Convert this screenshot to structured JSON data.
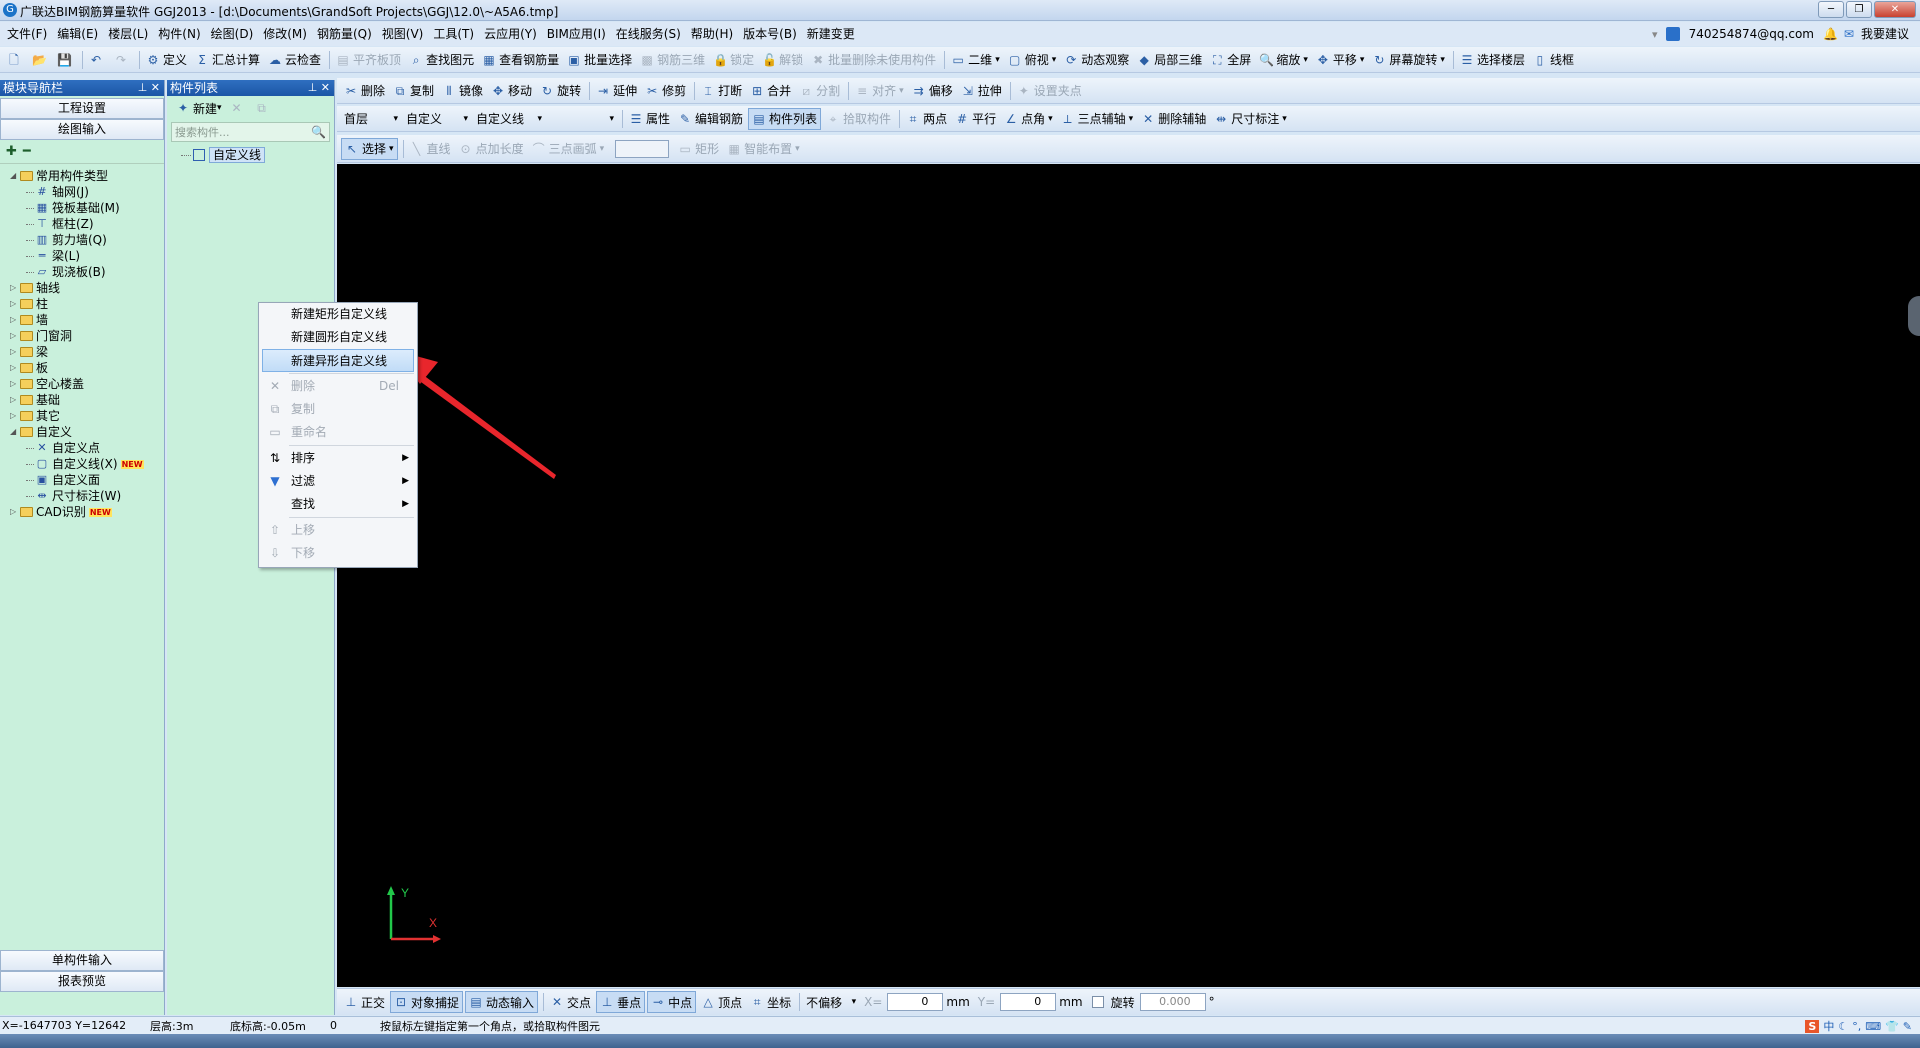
{
  "window": {
    "title": "广联达BIM钢筋算量软件 GGJ2013 - [d:\\Documents\\GrandSoft Projects\\GGJ\\12.0\\~A5A6.tmp]",
    "account": "740254874@qq.com",
    "help_label": "我要建议"
  },
  "menu": [
    "文件(F)",
    "编辑(E)",
    "楼层(L)",
    "构件(N)",
    "绘图(D)",
    "修改(M)",
    "钢筋量(Q)",
    "视图(V)",
    "工具(T)",
    "云应用(Y)",
    "BIM应用(I)",
    "在线服务(S)",
    "帮助(H)",
    "版本号(B)",
    "新建变更"
  ],
  "toolbar1": [
    "定义",
    "汇总计算",
    "云检查",
    "平齐板顶",
    "查找图元",
    "查看钢筋量",
    "批量选择",
    "钢筋三维",
    "锁定",
    "解锁",
    "批量删除未使用构件",
    "二维",
    "俯视",
    "动态观察",
    "局部三维",
    "全屏",
    "缩放",
    "平移",
    "屏幕旋转",
    "选择楼层",
    "线框"
  ],
  "toolbar2": [
    "删除",
    "复制",
    "镜像",
    "移动",
    "旋转",
    "延伸",
    "修剪",
    "打断",
    "合并",
    "分割",
    "对齐",
    "偏移",
    "拉伸",
    "设置夹点"
  ],
  "toolbar3": {
    "floor": "首层",
    "category": "自定义",
    "component": "自定义线",
    "items": [
      "属性",
      "编辑钢筋",
      "构件列表",
      "拾取构件",
      "两点",
      "平行",
      "点角",
      "三点辅轴",
      "删除辅轴",
      "尺寸标注"
    ]
  },
  "toolbar4": [
    "选择",
    "直线",
    "点加长度",
    "三点画弧",
    "矩形",
    "智能布置"
  ],
  "nav_panel": {
    "title": "模块导航栏",
    "project_settings": "工程设置",
    "drawing_input": "绘图输入",
    "single_input": "单构件输入",
    "report_preview": "报表预览",
    "tree": [
      {
        "label": "常用构件类型",
        "level": 0,
        "type": "folder-open"
      },
      {
        "label": "轴网(J)",
        "level": 1,
        "type": "grid-icon"
      },
      {
        "label": "筏板基础(M)",
        "level": 1,
        "type": "raft-icon"
      },
      {
        "label": "框柱(Z)",
        "level": 1,
        "type": "column-icon"
      },
      {
        "label": "剪力墙(Q)",
        "level": 1,
        "type": "wall-icon"
      },
      {
        "label": "梁(L)",
        "level": 1,
        "type": "beam-icon"
      },
      {
        "label": "现浇板(B)",
        "level": 1,
        "type": "slab-icon"
      },
      {
        "label": "轴线",
        "level": 0,
        "type": "folder"
      },
      {
        "label": "柱",
        "level": 0,
        "type": "folder"
      },
      {
        "label": "墙",
        "level": 0,
        "type": "folder"
      },
      {
        "label": "门窗洞",
        "level": 0,
        "type": "folder"
      },
      {
        "label": "梁",
        "level": 0,
        "type": "folder"
      },
      {
        "label": "板",
        "level": 0,
        "type": "folder"
      },
      {
        "label": "空心楼盖",
        "level": 0,
        "type": "folder"
      },
      {
        "label": "基础",
        "level": 0,
        "type": "folder"
      },
      {
        "label": "其它",
        "level": 0,
        "type": "folder"
      },
      {
        "label": "自定义",
        "level": 0,
        "type": "folder-open"
      },
      {
        "label": "自定义点",
        "level": 1,
        "type": "point-icon"
      },
      {
        "label": "自定义线(X)",
        "level": 1,
        "type": "line-icon",
        "badge": "NEW"
      },
      {
        "label": "自定义面",
        "level": 1,
        "type": "face-icon"
      },
      {
        "label": "尺寸标注(W)",
        "level": 1,
        "type": "dim-icon"
      },
      {
        "label": "CAD识别",
        "level": 0,
        "type": "folder",
        "badge": "NEW"
      }
    ]
  },
  "component_list": {
    "title": "构件列表",
    "new_label": "新建",
    "search_placeholder": "搜索构件...",
    "items": [
      "自定义线"
    ]
  },
  "context_menu": [
    {
      "label": "新建矩形自定义线",
      "enabled": true
    },
    {
      "label": "新建圆形自定义线",
      "enabled": true
    },
    {
      "label": "新建异形自定义线",
      "enabled": true,
      "highlighted": true
    },
    {
      "label": "删除",
      "enabled": false,
      "shortcut": "Del"
    },
    {
      "label": "复制",
      "enabled": false
    },
    {
      "label": "重命名",
      "enabled": false
    },
    {
      "label": "排序",
      "enabled": true,
      "submenu": true
    },
    {
      "label": "过滤",
      "enabled": true,
      "submenu": true
    },
    {
      "label": "查找",
      "enabled": true,
      "submenu": true
    },
    {
      "label": "上移",
      "enabled": false
    },
    {
      "label": "下移",
      "enabled": false
    }
  ],
  "snap_bar": {
    "items": [
      "正交",
      "对象捕捉",
      "动态输入",
      "交点",
      "垂点",
      "中点",
      "顶点",
      "坐标"
    ],
    "offset": "不偏移",
    "x_label": "X=",
    "x_value": "0",
    "y_label": "Y=",
    "y_value": "0",
    "unit": "mm",
    "rotate_label": "旋转",
    "rotate_value": "0.000",
    "degree": "°"
  },
  "status": {
    "coords": "X=-1647703 Y=12642",
    "floor_height": "层高:3m",
    "base_height": "底标高:-0.05m",
    "count": "0",
    "hint": "按鼠标左键指定第一个角点，或拾取构件图元"
  },
  "axis": {
    "x": "X",
    "y": "Y"
  },
  "colors": {
    "canvas": "#000000",
    "accent": "#1b56a6",
    "panel": "#c9f0dc",
    "arrow": "#e8262c"
  }
}
